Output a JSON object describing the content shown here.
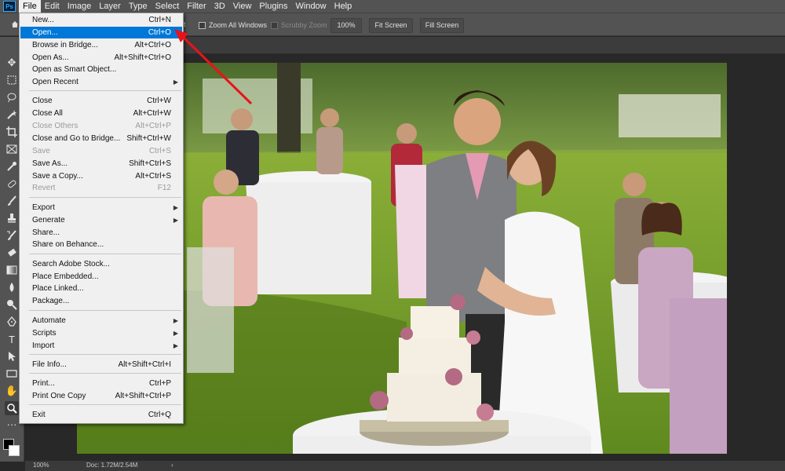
{
  "menubar": {
    "logo": "Ps",
    "items": [
      "File",
      "Edit",
      "Image",
      "Layer",
      "Type",
      "Select",
      "Filter",
      "3D",
      "View",
      "Plugins",
      "Window",
      "Help"
    ],
    "active": "File"
  },
  "options": {
    "cut_text": "t",
    "zoom_all_windows": "Zoom All Windows",
    "scrubby_zoom": "Scrubby Zoom",
    "zoom_value": "100%",
    "fit_screen": "Fit Screen",
    "fill_screen": "Fill Screen"
  },
  "file_menu": {
    "items": [
      {
        "label": "New...",
        "shortcut": "Ctrl+N",
        "enabled": true
      },
      {
        "label": "Open...",
        "shortcut": "Ctrl+O",
        "enabled": true,
        "highlighted": true
      },
      {
        "label": "Browse in Bridge...",
        "shortcut": "Alt+Ctrl+O",
        "enabled": true
      },
      {
        "label": "Open As...",
        "shortcut": "Alt+Shift+Ctrl+O",
        "enabled": true
      },
      {
        "label": "Open as Smart Object...",
        "shortcut": "",
        "enabled": true
      },
      {
        "label": "Open Recent",
        "shortcut": "",
        "enabled": true,
        "submenu": true
      },
      {
        "label": "Close",
        "shortcut": "Ctrl+W",
        "enabled": true
      },
      {
        "label": "Close All",
        "shortcut": "Alt+Ctrl+W",
        "enabled": true
      },
      {
        "label": "Close Others",
        "shortcut": "Alt+Ctrl+P",
        "enabled": false
      },
      {
        "label": "Close and Go to Bridge...",
        "shortcut": "Shift+Ctrl+W",
        "enabled": true
      },
      {
        "label": "Save",
        "shortcut": "Ctrl+S",
        "enabled": false
      },
      {
        "label": "Save As...",
        "shortcut": "Shift+Ctrl+S",
        "enabled": true
      },
      {
        "label": "Save a Copy...",
        "shortcut": "Alt+Ctrl+S",
        "enabled": true
      },
      {
        "label": "Revert",
        "shortcut": "F12",
        "enabled": false
      },
      {
        "label": "Export",
        "shortcut": "",
        "enabled": true,
        "submenu": true
      },
      {
        "label": "Generate",
        "shortcut": "",
        "enabled": true,
        "submenu": true
      },
      {
        "label": "Share...",
        "shortcut": "",
        "enabled": true
      },
      {
        "label": "Share on Behance...",
        "shortcut": "",
        "enabled": true
      },
      {
        "label": "Search Adobe Stock...",
        "shortcut": "",
        "enabled": true
      },
      {
        "label": "Place Embedded...",
        "shortcut": "",
        "enabled": true
      },
      {
        "label": "Place Linked...",
        "shortcut": "",
        "enabled": true
      },
      {
        "label": "Package...",
        "shortcut": "",
        "enabled": true
      },
      {
        "label": "Automate",
        "shortcut": "",
        "enabled": true,
        "submenu": true
      },
      {
        "label": "Scripts",
        "shortcut": "",
        "enabled": true,
        "submenu": true
      },
      {
        "label": "Import",
        "shortcut": "",
        "enabled": true,
        "submenu": true
      },
      {
        "label": "File Info...",
        "shortcut": "Alt+Shift+Ctrl+I",
        "enabled": true
      },
      {
        "label": "Print...",
        "shortcut": "Ctrl+P",
        "enabled": true
      },
      {
        "label": "Print One Copy",
        "shortcut": "Alt+Shift+Ctrl+P",
        "enabled": true
      },
      {
        "label": "Exit",
        "shortcut": "Ctrl+Q",
        "enabled": true
      }
    ]
  },
  "status": {
    "zoom": "100%",
    "doc": "Doc: 1.72M/2.54M",
    "arrow": "›"
  },
  "colors": {
    "highlight": "#0078d7",
    "annotation_arrow": "#e8131a",
    "ui_panel": "#535353"
  }
}
